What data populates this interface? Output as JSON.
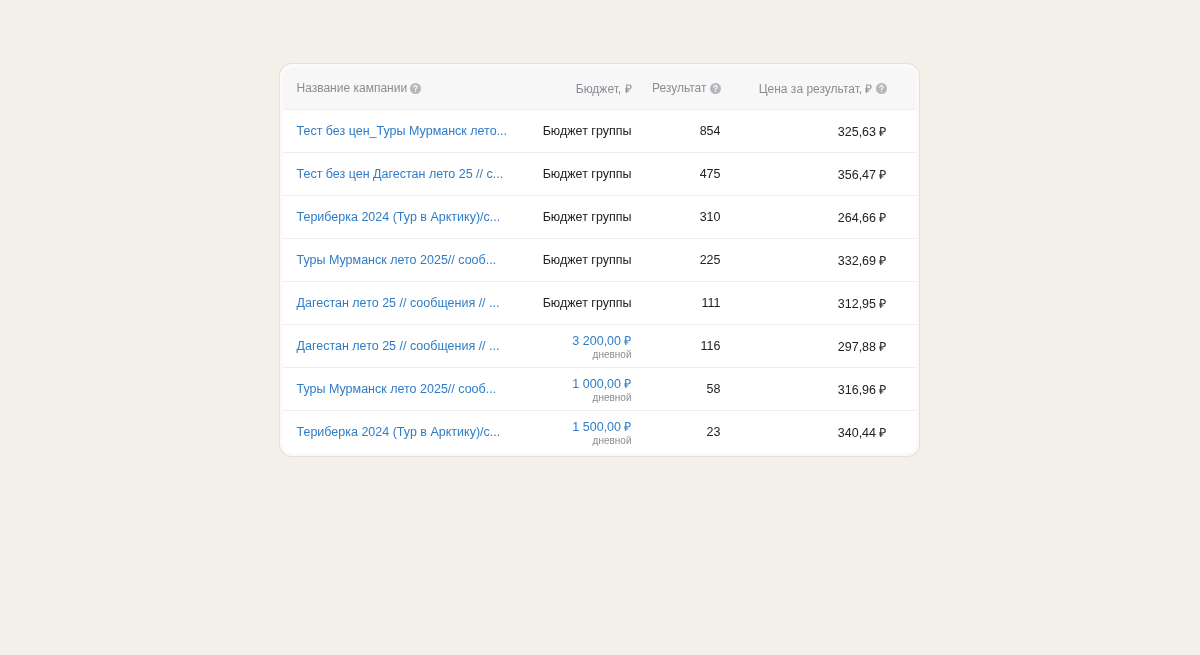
{
  "table": {
    "columns": [
      {
        "label": "Название кампании",
        "help": true
      },
      {
        "label": "Бюджет, ₽",
        "help": false
      },
      {
        "label": "Результат",
        "help": true
      },
      {
        "label": "Цена за результат, ₽",
        "help": true
      }
    ],
    "rows": [
      {
        "name": "Тест без цен_Туры Мурманск лето...",
        "budget": {
          "kind": "group",
          "value": "Бюджет группы"
        },
        "result": "854",
        "price": "325,63 ₽"
      },
      {
        "name": "Тест без цен Дагестан лето 25 // с...",
        "budget": {
          "kind": "group",
          "value": "Бюджет группы"
        },
        "result": "475",
        "price": "356,47 ₽"
      },
      {
        "name": "Териберка 2024 (Тур в Арктику)/с...",
        "budget": {
          "kind": "group",
          "value": "Бюджет группы"
        },
        "result": "310",
        "price": "264,66 ₽"
      },
      {
        "name": "Туры Мурманск лето 2025// сооб...",
        "budget": {
          "kind": "group",
          "value": "Бюджет группы"
        },
        "result": "225",
        "price": "332,69 ₽"
      },
      {
        "name": "Дагестан лето 25 // сообщения // ...",
        "budget": {
          "kind": "group",
          "value": "Бюджет группы"
        },
        "result": "111",
        "price": "312,95 ₽"
      },
      {
        "name": "Дагестан лето 25 // сообщения // ...",
        "budget": {
          "kind": "daily",
          "value": "3 200,00 ₽",
          "note": "дневной"
        },
        "result": "116",
        "price": "297,88 ₽"
      },
      {
        "name": "Туры Мурманск лето 2025// сооб...",
        "budget": {
          "kind": "daily",
          "value": "1 000,00 ₽",
          "note": "дневной"
        },
        "result": "58",
        "price": "316,96 ₽"
      },
      {
        "name": "Териберка 2024 (Тур в Арктику)/с...",
        "budget": {
          "kind": "daily",
          "value": "1 500,00 ₽",
          "note": "дневной"
        },
        "result": "23",
        "price": "340,44 ₽"
      }
    ]
  }
}
